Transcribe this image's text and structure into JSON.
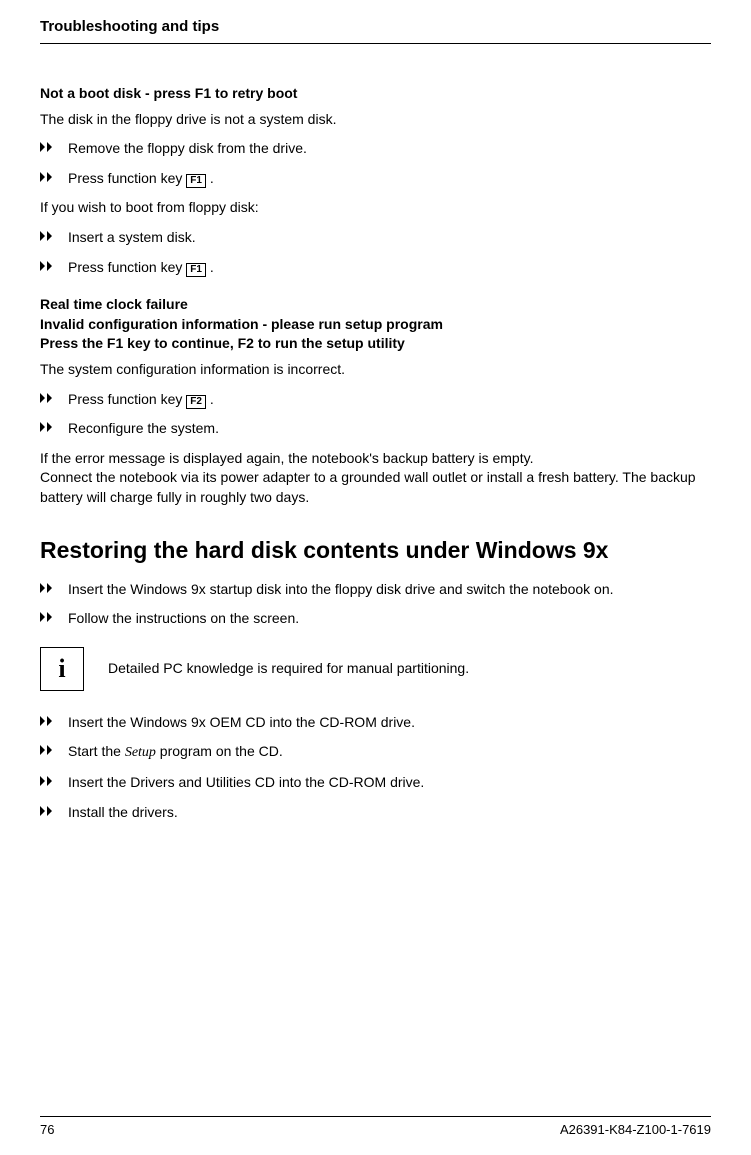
{
  "header": "Troubleshooting and tips",
  "section1": {
    "heading": "Not a boot disk - press F1 to retry boot",
    "intro": "The disk in the floppy drive is not a system disk.",
    "steps_a": [
      "Remove the floppy disk from the drive."
    ],
    "step_a2_prefix": "Press function key ",
    "step_a2_key": "F1",
    "step_a2_suffix": " .",
    "mid": "If you wish to boot from floppy disk:",
    "steps_b": [
      "Insert a system disk."
    ],
    "step_b2_prefix": "Press function key ",
    "step_b2_key": "F1",
    "step_b2_suffix": " ."
  },
  "section2": {
    "heading_lines": [
      "Real time clock failure",
      "Invalid configuration information - please run setup program",
      "Press the F1 key to continue, F2 to run the setup utility"
    ],
    "intro": "The system configuration information is incorrect.",
    "step1_prefix": "Press function key ",
    "step1_key": "F2",
    "step1_suffix": " .",
    "step2": "Reconfigure the system.",
    "tail_line1": "If the error message is displayed again, the notebook's backup battery is empty.",
    "tail_line2": "Connect the notebook via its power adapter to a grounded wall outlet or install a fresh battery. The backup battery will charge fully in roughly two days."
  },
  "section3": {
    "heading": "Restoring the hard disk contents under Windows 9x",
    "steps_a": [
      "Insert the Windows 9x startup disk into the floppy disk drive and switch the notebook on.",
      "Follow the instructions on the screen."
    ],
    "info_icon": "i",
    "info_text": "Detailed PC knowledge is required for manual partitioning.",
    "steps_b_0": "Insert the Windows 9x OEM CD into the CD-ROM drive.",
    "steps_b_1_prefix": "Start the ",
    "steps_b_1_italic": "Setup",
    "steps_b_1_suffix": " program on the CD.",
    "steps_b_2": "Insert the Drivers and Utilities CD into the CD-ROM drive.",
    "steps_b_3": "Install the drivers."
  },
  "footer": {
    "page": "76",
    "doc_id": "A26391-K84-Z100-1-7619"
  }
}
